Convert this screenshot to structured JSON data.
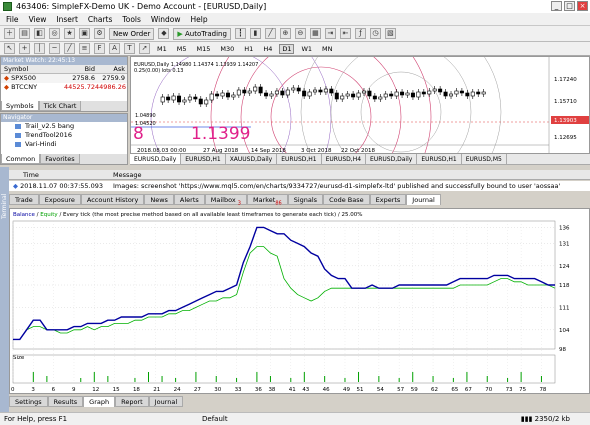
{
  "window": {
    "title": "463406: SimpleFX-Demo UK - Demo Account - [EURUSD,Daily]",
    "min": "_",
    "max": "□",
    "close": "×"
  },
  "menu": [
    "File",
    "View",
    "Insert",
    "Charts",
    "Tools",
    "Window",
    "Help"
  ],
  "toolbar": {
    "new_order": "New Order",
    "autotrading": "AutoTrading",
    "timeframes": [
      "M1",
      "M5",
      "M15",
      "M30",
      "H1",
      "H4",
      "D1",
      "W1",
      "MN"
    ],
    "selected_timeframe": "D1"
  },
  "market_watch": {
    "header": "Market Watch: 22:45:13",
    "columns": [
      "Symbol",
      "Bid",
      "Ask"
    ],
    "rows": [
      {
        "symbol": "SPX500",
        "bid": "2758.6",
        "ask": "2759.9"
      },
      {
        "symbol": "BTCCNY",
        "bid": "44525.72",
        "ask": "44986.26"
      }
    ],
    "tabs": [
      "Symbols",
      "Tick Chart"
    ],
    "active_tab": "Symbols"
  },
  "navigator": {
    "header": "Navigator",
    "items": [
      "Trail_v2.5 bang",
      "TrendTool2016",
      "Vari-Hindi"
    ],
    "tabs": [
      "Common",
      "Favorites"
    ],
    "active_tab": "Common"
  },
  "chart": {
    "info": "EURUSD,Daily 1.14980 1.14374 1.13939 1.14207",
    "subinfo": "0.25(0.00) lots 0.13",
    "price_overlay": "1.1399",
    "overlay_prefix": "8",
    "price_labels": [
      "1.17240",
      "1.15710",
      "1.13903",
      "1.12695"
    ],
    "current_price": "1.13903",
    "date_labels": [
      "2018.08.03 00:00",
      "27 Aug 2018",
      "14 Sep 2018",
      "3 Oct 2018",
      "22 Oct 2018"
    ],
    "marker_labels": [
      "1.04890",
      "1.04520"
    ]
  },
  "chart_tabs": [
    "EURUSD,Daily",
    "EURUSD,H1",
    "XAUUSD,Daily",
    "EURUSD,H1",
    "EURUSD,H4",
    "EURUSD,Daily",
    "EURUSD,H1",
    "EURUSD,M5"
  ],
  "active_chart_tab": "EURUSD,Daily",
  "terminal": {
    "side_label": "Terminal",
    "columns": [
      "Time",
      "Message"
    ],
    "row": {
      "time": "2018.11.07 00:37:55.093",
      "message": "Images: screenshot 'https://www.mql5.com/en/charts/9334727/eurusd-d1-simplefx-ltd' published and successfully bound to user 'aossaa'"
    },
    "tabs": [
      "Trade",
      "Exposure",
      "Account History",
      "News",
      "Alerts",
      "Mailbox",
      "Market",
      "Signals",
      "Code Base",
      "Experts",
      "Journal"
    ],
    "tab_badges": {
      "Mailbox": "3",
      "Market": "86"
    },
    "active_tab": "Journal"
  },
  "graph": {
    "legend_balance": "Balance",
    "legend_equity": "Equity",
    "legend_rest": " / Every tick (the most precise method based on all available least timeframes to generate each tick) / 25.00%",
    "size_label": "Size",
    "tabs": [
      "Settings",
      "Results",
      "Graph",
      "Report",
      "Journal"
    ],
    "active_tab": "Graph"
  },
  "chart_data": {
    "type": "line",
    "x": [
      0,
      1,
      2,
      3,
      4,
      5,
      6,
      7,
      8,
      9,
      10,
      11,
      12,
      13,
      14,
      15,
      16,
      17,
      18,
      19,
      20,
      21,
      22,
      23,
      24,
      25,
      26,
      27,
      28,
      29,
      30,
      31,
      32,
      33,
      34,
      35,
      36,
      37,
      38,
      39,
      40,
      41,
      42,
      43,
      44,
      45,
      46,
      47,
      48,
      49,
      50,
      51,
      52,
      53,
      54,
      55,
      56,
      57,
      58,
      59,
      60,
      61,
      62,
      63,
      64,
      65,
      66,
      67,
      68,
      69,
      70,
      71,
      72,
      73,
      74,
      75,
      76,
      77,
      78,
      79,
      80
    ],
    "xticks": [
      0,
      3,
      6,
      9,
      12,
      15,
      18,
      21,
      24,
      27,
      30,
      33,
      36,
      38,
      41,
      43,
      46,
      49,
      51,
      54,
      57,
      59,
      62,
      65,
      67,
      70,
      73,
      75,
      78
    ],
    "series": [
      {
        "name": "Balance",
        "color": "#0000a0",
        "values": [
          101,
          101,
          104,
          107,
          107,
          104,
          104,
          104,
          104,
          105,
          105,
          106,
          106,
          106,
          107,
          107,
          108,
          108,
          108,
          108,
          109,
          109,
          109,
          110,
          110,
          111,
          112,
          113,
          114,
          115,
          116,
          116,
          117,
          118,
          125,
          130,
          136,
          136,
          135,
          134,
          134,
          132,
          131,
          130,
          128,
          127,
          123,
          121,
          120,
          120,
          117,
          117,
          117,
          118,
          117,
          117,
          117,
          118,
          118,
          118,
          118,
          118,
          118,
          118,
          118,
          119,
          120,
          120,
          120,
          120,
          120,
          121,
          121,
          121,
          120,
          120,
          120,
          120,
          119,
          118,
          118
        ]
      },
      {
        "name": "Equity",
        "color": "#00b000",
        "values": [
          101,
          101,
          104,
          105,
          105,
          104,
          104,
          103,
          103,
          104,
          104,
          105,
          104,
          105,
          105,
          106,
          106,
          106,
          107,
          107,
          108,
          108,
          108,
          109,
          109,
          110,
          110,
          111,
          112,
          113,
          113,
          114,
          114,
          115,
          122,
          128,
          130,
          130,
          128,
          127,
          120,
          117,
          115,
          114,
          113,
          114,
          116,
          117,
          117,
          117,
          117,
          117,
          117,
          117,
          117,
          117,
          117,
          117,
          117,
          117,
          117,
          117,
          117,
          117,
          117,
          117,
          118,
          118,
          118,
          118,
          118,
          119,
          120,
          120,
          119,
          119,
          118,
          118,
          118,
          118,
          117
        ]
      }
    ],
    "ylim": [
      98,
      138
    ],
    "yticks": [
      98,
      104,
      111,
      118,
      124,
      131,
      136
    ]
  }
}
